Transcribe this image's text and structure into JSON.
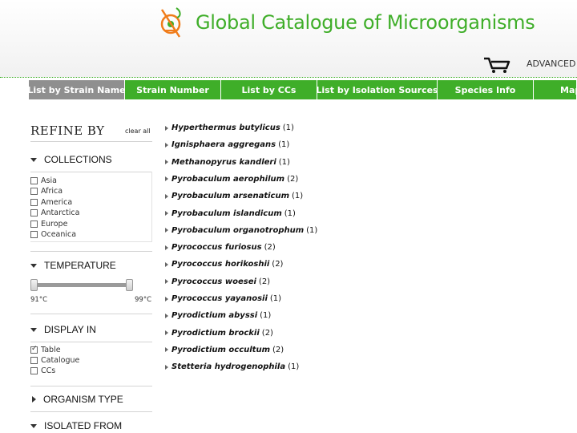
{
  "header": {
    "title": "Global Catalogue of Microorganisms",
    "advanced_label": "ADVANCED",
    "accent_color": "#3fae29"
  },
  "nav": {
    "tabs": [
      {
        "label": "List by Strain Name",
        "active": true
      },
      {
        "label": "Strain Number",
        "active": false
      },
      {
        "label": "List by CCs",
        "active": false
      },
      {
        "label": "List by Isolation Sources",
        "active": false
      },
      {
        "label": "Species Info",
        "active": false
      },
      {
        "label": "Map",
        "active": false
      }
    ]
  },
  "sidebar": {
    "title": "REFINE BY",
    "clear_all": "clear all",
    "collections": {
      "label": "COLLECTIONS",
      "items": [
        "Asia",
        "Africa",
        "America",
        "Antarctica",
        "Europe",
        "Oceanica"
      ]
    },
    "temperature": {
      "label": "TEMPERATURE",
      "min_label": "91°C",
      "max_label": "99°C",
      "range_low_fraction": 0.0,
      "range_high_fraction": 1.0
    },
    "display_in": {
      "label": "DISPLAY IN",
      "items": [
        {
          "label": "Table",
          "checked": true
        },
        {
          "label": "Catalogue",
          "checked": false
        },
        {
          "label": "CCs",
          "checked": false
        }
      ]
    },
    "organism_type": {
      "label": "ORGANISM TYPE"
    },
    "isolated_from": {
      "label": "ISOLATED FROM"
    }
  },
  "species": [
    {
      "name": "Hyperthermus butylicus",
      "count": "(1)"
    },
    {
      "name": "Ignisphaera aggregans",
      "count": "(1)"
    },
    {
      "name": "Methanopyrus kandleri",
      "count": "(1)"
    },
    {
      "name": "Pyrobaculum aerophilum",
      "count": "(2)"
    },
    {
      "name": "Pyrobaculum arsenaticum",
      "count": "(1)"
    },
    {
      "name": "Pyrobaculum islandicum",
      "count": "(1)"
    },
    {
      "name": "Pyrobaculum organotrophum",
      "count": "(1)"
    },
    {
      "name": "Pyrococcus furiosus",
      "count": "(2)"
    },
    {
      "name": "Pyrococcus horikoshii",
      "count": "(2)"
    },
    {
      "name": "Pyrococcus woesei",
      "count": "(2)"
    },
    {
      "name": "Pyrococcus yayanosii",
      "count": "(1)"
    },
    {
      "name": "Pyrodictium abyssi",
      "count": "(1)"
    },
    {
      "name": "Pyrodictium brockii",
      "count": "(2)"
    },
    {
      "name": "Pyrodictium occultum",
      "count": "(2)"
    },
    {
      "name": "Stetteria hydrogenophila",
      "count": "(1)"
    }
  ]
}
